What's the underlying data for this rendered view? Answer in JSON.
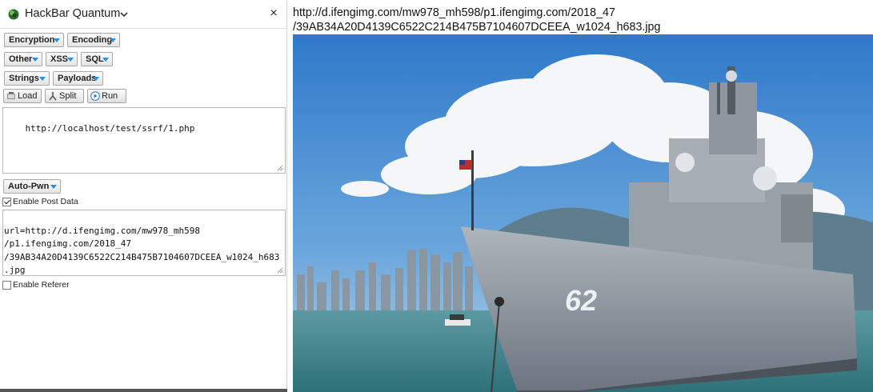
{
  "hackbar": {
    "title": "HackBar Quantum",
    "close_glyph": "×",
    "logo_icon": "hackbar-logo-icon",
    "menus_row1": [
      "Encryption",
      "Encoding"
    ],
    "menus_row2": [
      "Other",
      "XSS",
      "SQL"
    ],
    "menus_row3": [
      "Strings",
      "Payloads"
    ],
    "actions": {
      "load": "Load",
      "split": "Split",
      "run": "Run"
    },
    "url_value": "http://localhost/test/ssrf/1.php",
    "auto_pwn": "Auto-Pwn",
    "enable_post_label": "Enable Post Data",
    "enable_post_checked": true,
    "post_value_lines": [
      "url=http://d.ifengimg.com/mw978_mh598",
      "/p1.ifengimg.com/2018_47",
      "/39AB34A20D4139C6522C214B475B7104607DCEEA_w1024_h683",
      ".jpg"
    ],
    "enable_referer_label": "Enable Referer",
    "enable_referer_checked": false
  },
  "page": {
    "url_line1": "http://d.ifengimg.com/mw978_mh598/p1.ifengimg.com/2018_47",
    "url_line2": "/39AB34A20D4139C6522C214B475B7104607DCEEA_w1024_h683.jpg",
    "image_icon": "warship-photo"
  },
  "colors": {
    "caret_blue": "#2a8fd8",
    "sky": "#4f8fd0",
    "sea": "#3d8a92"
  }
}
